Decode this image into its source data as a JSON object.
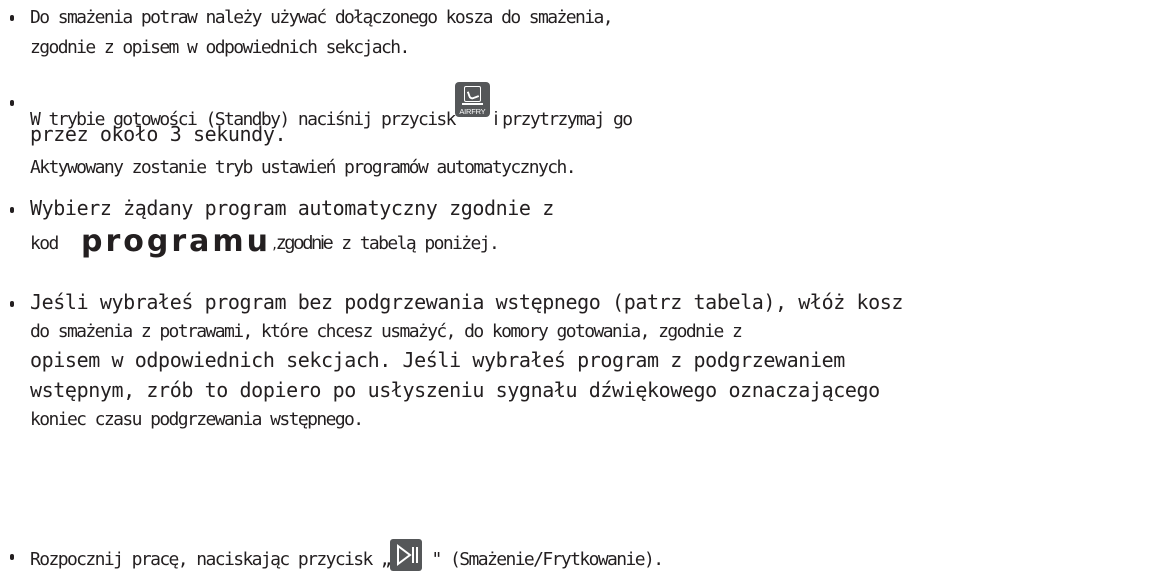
{
  "items": [
    {
      "lines": [
        "Do smażenia potraw należy używać dołączonego kosza do smażenia,",
        "zgodnie z opisem w odpowiednich sekcjach."
      ]
    },
    {
      "line1_before": "W trybie gotowości (Standby) naciśnij przycisk",
      "icon_label": "AIRFRY",
      "line1_conj": "i",
      "line1_after": "przytrzymaj go",
      "line2": "przez około 3 sekundy.",
      "line3": "Aktywowany zostanie tryb ustawień programów automatycznych."
    },
    {
      "line1": "Wybierz żądany program automatyczny zgodnie z",
      "line2_kod": "kod",
      "line2_program": "programu",
      "line2_comma": ",",
      "line2_zgodnie": "zgodnie",
      "line2_rest": "z tabelą poniżej."
    },
    {
      "lines": [
        "Jeśli wybrałeś program bez podgrzewania wstępnego (patrz tabela), włóż kosz",
        "do smażenia z potrawami, które chcesz usmażyć, do komory gotowania, zgodnie z",
        "opisem w odpowiednich sekcjach. Jeśli wybrałeś program z podgrzewaniem",
        "wstępnym, zrób to dopiero po usłyszeniu sygnału dźwiękowego oznaczającego",
        "koniec czasu podgrzewania wstępnego."
      ]
    },
    {
      "before": "Rozpocznij pracę, naciskając przycisk",
      "open_quote": "„",
      "close_quote": "\"",
      "after": "(Smażenie/Frytkowanie).",
      "icon": "play-pause-icon"
    }
  ],
  "colors": {
    "text": "#231f20",
    "icon_bg": "#555759",
    "icon_fg": "#ffffff"
  }
}
